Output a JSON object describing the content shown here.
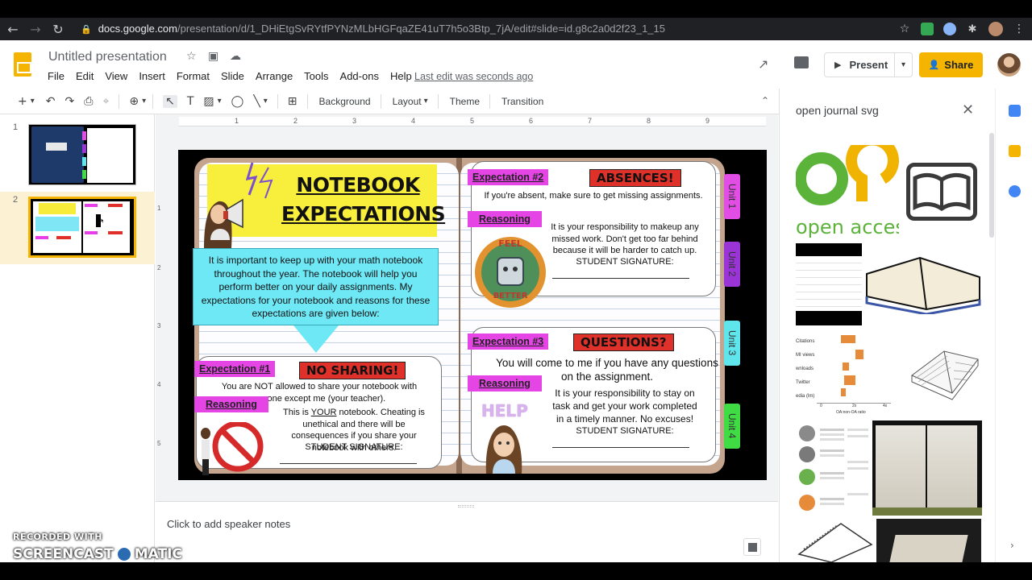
{
  "browser": {
    "url_host": "docs.google.com",
    "url_path": "/presentation/d/1_DHiEtgSvRYtfPYNzMLbHGFqaZE41uT7h5o3Btp_7jA/edit#slide=id.g8c2a0d2f23_1_15",
    "back_icon": "←",
    "forward_icon": "→",
    "reload_icon": "↻",
    "lock_icon": "🔒",
    "bookmark_icon": "☆",
    "puzzle_icon": "✱",
    "menu_icon": "⋮"
  },
  "docs": {
    "title": "Untitled presentation",
    "star_icon": "☆",
    "folder_icon": "▣",
    "cloud_icon": "☁",
    "menu": [
      "File",
      "Edit",
      "View",
      "Insert",
      "Format",
      "Slide",
      "Arrange",
      "Tools",
      "Add-ons",
      "Help"
    ],
    "last_edit": "Last edit was seconds ago",
    "activity_icon": "↗",
    "present_label": "Present",
    "present_play_icon": "▶",
    "present_caret": "▾",
    "share_label": "Share",
    "share_icon": "👤"
  },
  "toolbar": {
    "background": "Background",
    "layout": "Layout",
    "theme": "Theme",
    "transition": "Transition",
    "icons": {
      "add": "+",
      "caret": "▾",
      "undo": "↶",
      "redo": "↷",
      "print": "⎙",
      "paint": "⌖",
      "zoom": "⊕",
      "select": "↖",
      "textbox": "T",
      "image": "▨",
      "shape": "◯",
      "line": "╲",
      "comment": "⊞",
      "collapse": "⌃"
    }
  },
  "filmstrip": {
    "slides": [
      {
        "num": "1"
      },
      {
        "num": "2"
      }
    ]
  },
  "ruler": [
    "1",
    "2",
    "3",
    "4",
    "5",
    "6",
    "7",
    "8",
    "9"
  ],
  "vruler": [
    "1",
    "2",
    "3",
    "4",
    "5"
  ],
  "slide": {
    "title_line1": "NOTEBOOK",
    "title_line2": "EXPECTATIONS",
    "intro": "It is important to keep up with your math notebook throughout the year. The notebook will help you perform better on your daily assignments. My expectations for your notebook and reasons for these expectations are given below:",
    "units": [
      "Unit 1",
      "Unit 2",
      "Unit 3",
      "Unit 4"
    ],
    "expectation1": {
      "label": "Expectation #1",
      "heading": "NO SHARING!",
      "text": "You are NOT allowed to share your notebook with anyone except me (your teacher).",
      "reasoning_label": "Reasoning",
      "reason_pre": "This is ",
      "reason_emph": "YOUR",
      "reason_post": " notebook. Cheating is unethical and there will be consequences if you share your notebook with others.",
      "signature": "STUDENT SIGNATURE:"
    },
    "expectation2": {
      "label": "Expectation #2",
      "heading": "ABSENCES!",
      "text": "If you're absent, make sure to get missing assignments.",
      "reasoning_label": "Reasoning",
      "reason": "It is your responsibility to makeup any missed work. Don't get too far behind because it will be harder to catch up.",
      "signature": "STUDENT SIGNATURE:",
      "badge_top": "FEEL",
      "badge_bottom": "BETTER"
    },
    "expectation3": {
      "label": "Expectation #3",
      "heading": "QUESTIONS?",
      "text": "You will come to me if you have any questions on the assignment.",
      "reasoning_label": "Reasoning",
      "reason": "It is your responsibility to stay on task and get your work completed in a timely manner. No excuses!",
      "signature": "STUDENT SIGNATURE:",
      "help": "HELP"
    }
  },
  "notes": {
    "placeholder": "Click to add speaker notes"
  },
  "sidepanel": {
    "query": "open journal svg",
    "close_icon": "✕",
    "oa_text": "open acces",
    "chart_rows": [
      "Citations",
      "MI views",
      "wnloads",
      "Twitter",
      "edia (lm)"
    ],
    "chart_axis": [
      "0",
      "2x",
      "4x"
    ],
    "chart_xlabel": "OA:non-OA ratio"
  },
  "rail": {
    "chevron": "›"
  },
  "watermark": {
    "recorded": "RECORDED WITH",
    "brand_left": "SCREENCAST",
    "brand_right": "MATIC"
  },
  "colors": {
    "slides_yellow": "#f4b400",
    "title_yellow": "#f7ef3b",
    "intro_cyan": "#6fe8f6",
    "label_pink": "#e645e6",
    "label_red": "#e0302a",
    "unit1": "#e24de6",
    "unit2": "#9b34d6",
    "unit3": "#5ee6ec",
    "unit4": "#3fdc44"
  }
}
